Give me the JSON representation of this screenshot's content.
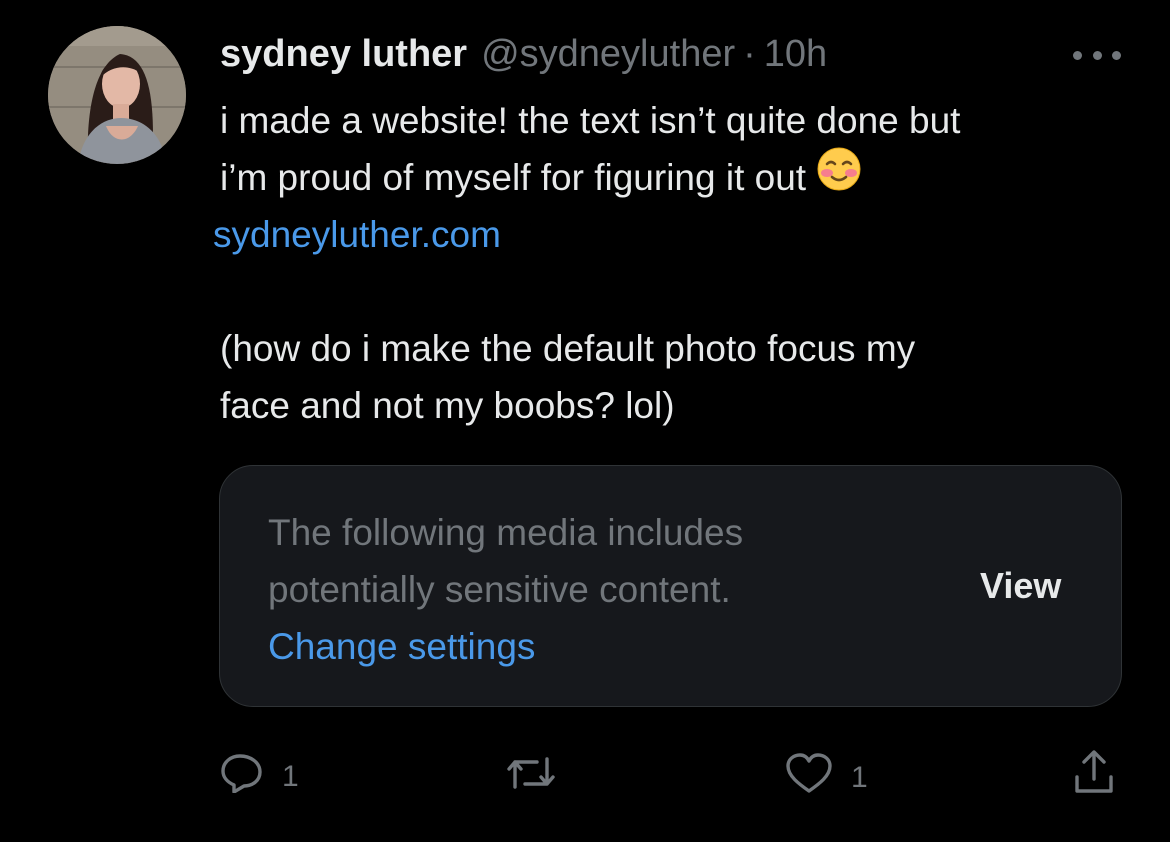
{
  "author": {
    "name": "sydney luther",
    "handle": "@sydneyluther",
    "separator": "·",
    "time": "10h",
    "avatar_icon": "profile-photo"
  },
  "tweet": {
    "lines": [
      "i made a website! the text isn’t quite done but",
      "i’m proud of myself for figuring it out"
    ],
    "emoji": "smiling-face-with-blush",
    "link": "sydneyluther.com",
    "paragraph2": [
      "(how do i make the default photo focus my",
      "face and not my boobs? lol)"
    ]
  },
  "media_warning": {
    "line1": "The following media includes",
    "line2": "potentially sensitive content.",
    "change_settings": "Change settings",
    "view_label": "View"
  },
  "actions": {
    "reply_count": "1",
    "like_count": "1",
    "icons": [
      "reply-icon",
      "retweet-icon",
      "like-icon",
      "share-icon"
    ]
  },
  "colors": {
    "background": "#000000",
    "text": "#e7e9ea",
    "muted": "#71767b",
    "link": "#4a99e9",
    "card": "#16181c"
  }
}
